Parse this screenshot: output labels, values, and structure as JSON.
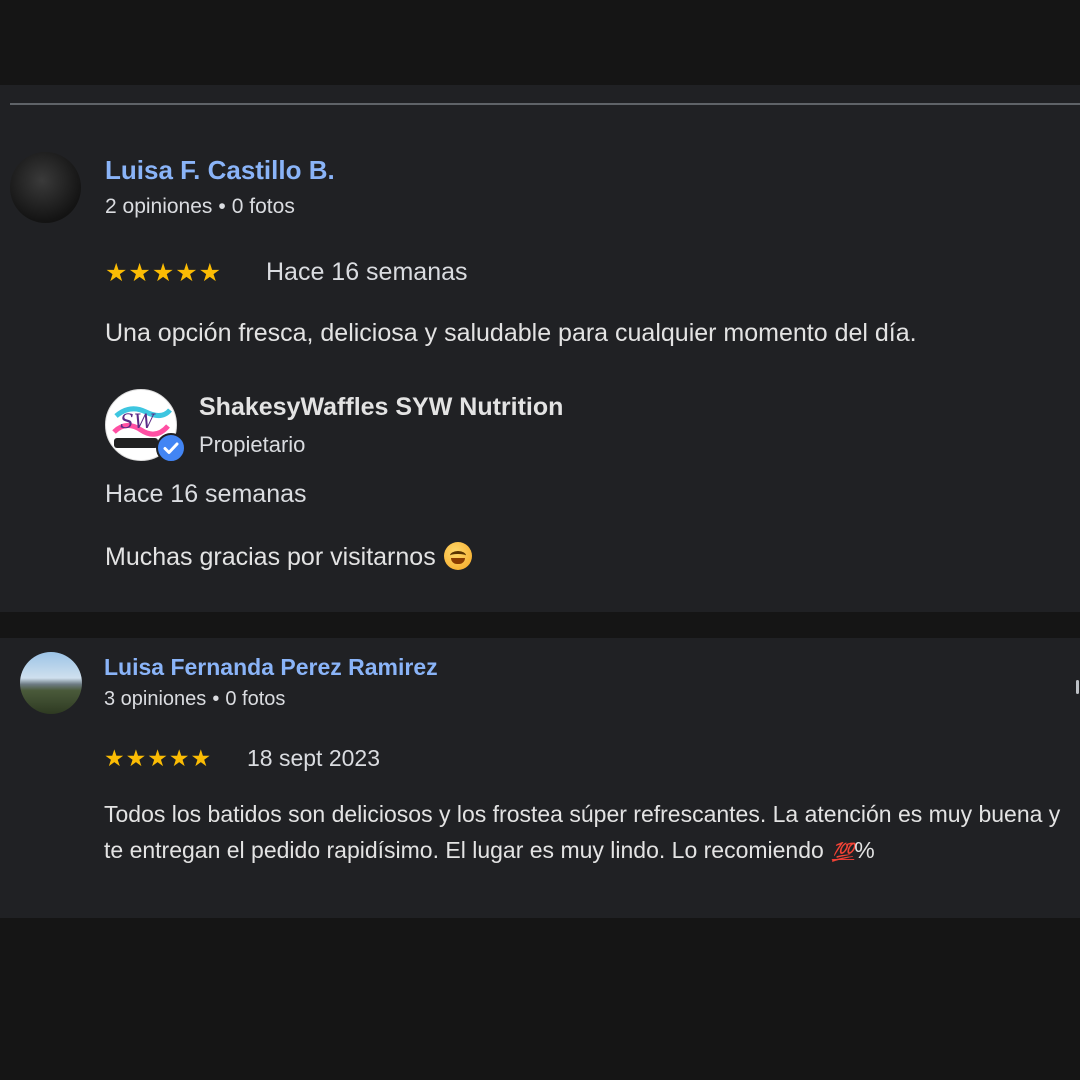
{
  "reviews": [
    {
      "author": "Luisa F. Castillo B.",
      "reviews_count": "2 opiniones",
      "photos_count": "0 fotos",
      "separator": "•",
      "rating": 5,
      "stars": "★★★★★",
      "date": "Hace 16 semanas",
      "text": "Una opción fresca, deliciosa y saludable para cualquier momento del día.",
      "owner_reply": {
        "name": "ShakesyWaffles SYW Nutrition",
        "role": "Propietario",
        "date": "Hace 16 semanas",
        "text": "Muchas gracias por visitarnos",
        "emoji": "smiling-face-with-open-hands-emoji"
      }
    },
    {
      "author": "Luisa Fernanda Perez Ramirez",
      "reviews_count": "3 opiniones",
      "photos_count": "0 fotos",
      "separator": "•",
      "rating": 5,
      "stars": "★★★★★",
      "date": "18 sept 2023",
      "text": "Todos los batidos son deliciosos y los frostea súper refrescantes. La atención es muy buena y te entregan el pedido rapidísimo. El lugar es muy lindo. Lo recomiendo",
      "emoji_100": "💯",
      "suffix": "%"
    }
  ],
  "colors": {
    "page_bg": "#151515",
    "panel_bg": "#202124",
    "author_link": "#8ab4f8",
    "star": "#fbbc04",
    "verified": "#4285f4"
  }
}
